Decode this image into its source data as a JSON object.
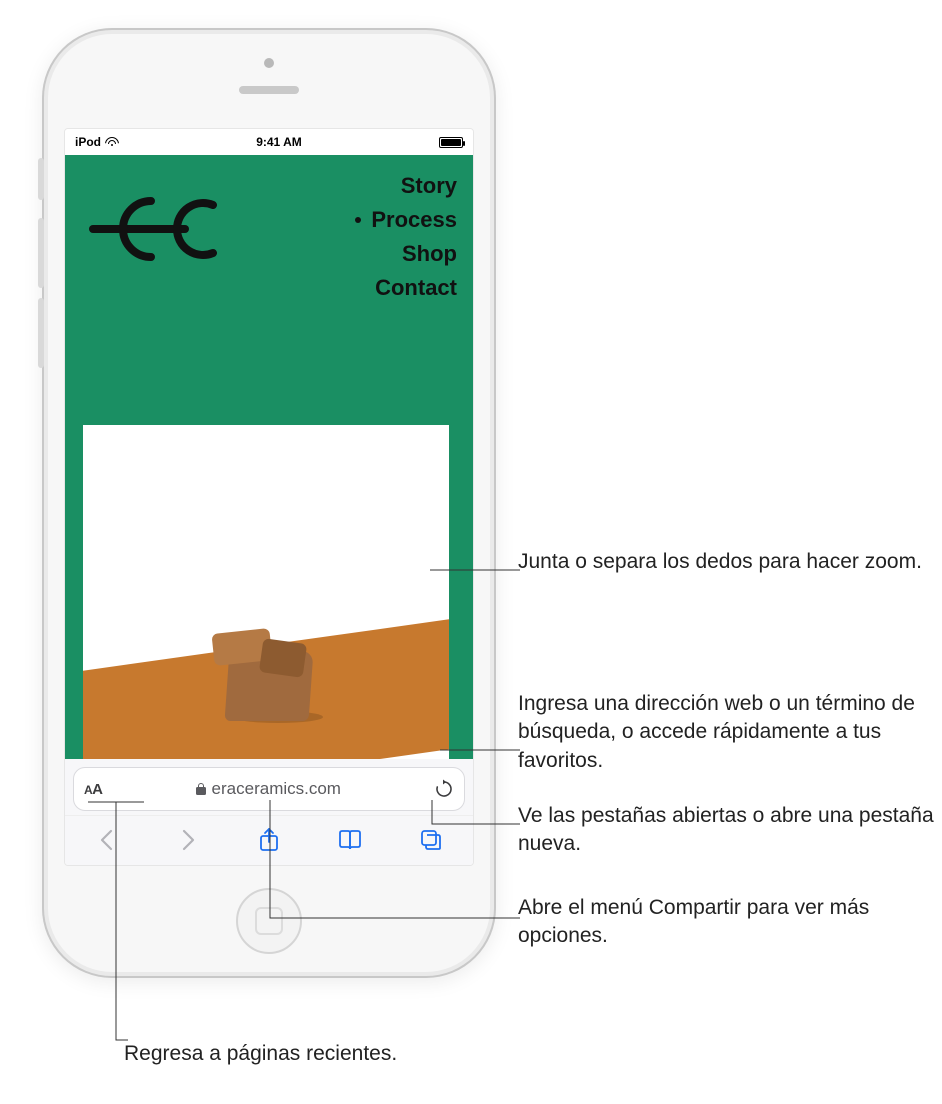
{
  "status_bar": {
    "carrier": "iPod",
    "time": "9:41 AM",
    "wifi_icon": "wifi-icon",
    "battery_icon": "battery-icon"
  },
  "website": {
    "logo_name": "site-logo",
    "nav_items": [
      {
        "label": "Story",
        "active": false
      },
      {
        "label": "Process",
        "active": true
      },
      {
        "label": "Shop",
        "active": false
      },
      {
        "label": "Contact",
        "active": false
      }
    ]
  },
  "address_bar": {
    "reader_button": "AA",
    "lock_icon": "lock-icon",
    "url": "eraceramics.com",
    "reload_icon": "reload-icon"
  },
  "toolbar": {
    "back_icon": "chevron-left-icon",
    "forward_icon": "chevron-right-icon",
    "share_icon": "share-icon",
    "bookmarks_icon": "book-icon",
    "tabs_icon": "tabs-icon"
  },
  "callouts": {
    "zoom": "Junta o separa los dedos para hacer zoom.",
    "address": "Ingresa una dirección web o un término de búsqueda, o accede rápidamente a tus favoritos.",
    "tabs": "Ve las pestañas abiertas o abre una pestaña nueva.",
    "share": "Abre el menú Compartir para ver más opciones.",
    "history": "Regresa a páginas recientes."
  }
}
